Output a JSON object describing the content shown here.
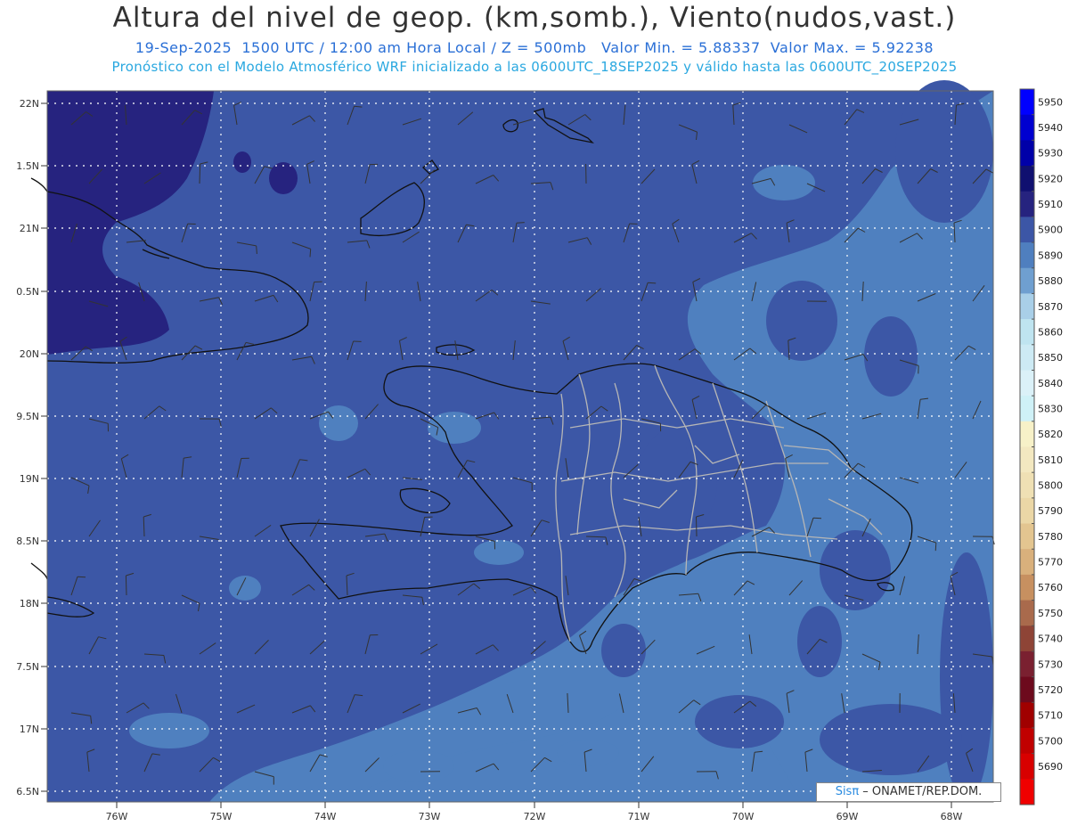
{
  "title": "Altura del nivel de geop. (km,somb.), Viento(nudos,vast.)",
  "subtitle1": "19-Sep-2025  1500 UTC / 12:00 am Hora Local / Z = 500mb   Valor Min. = 5.88337  Valor Max. = 5.92238",
  "subtitle2": "Pronóstico con el Modelo Atmosférico WRF inicializado a las 0600UTC_18SEP2025 y válido hasta las  0600UTC_20SEP2025",
  "lat_labels": [
    "22N",
    "1.5N",
    "21N",
    "0.5N",
    "20N",
    "9.5N",
    "19N",
    "8.5N",
    "18N",
    "7.5N",
    "17N",
    "6.5N"
  ],
  "lon_labels": [
    "76W",
    "75W",
    "74W",
    "73W",
    "72W",
    "71W",
    "70W",
    "69W",
    "68W"
  ],
  "colorbar": {
    "labels": [
      "5950",
      "5940",
      "5930",
      "5920",
      "5910",
      "5900",
      "5890",
      "5880",
      "5870",
      "5860",
      "5850",
      "5840",
      "5830",
      "5820",
      "5810",
      "5800",
      "5790",
      "5780",
      "5770",
      "5760",
      "5750",
      "5740",
      "5730",
      "5720",
      "5710",
      "5700",
      "5690"
    ],
    "colors": [
      "#0000ff",
      "#0000d0",
      "#0000a8",
      "#101070",
      "#26237f",
      "#3c56a6",
      "#4f7fbf",
      "#6f9fd0",
      "#a9cfe8",
      "#bfe4f0",
      "#cdeaf4",
      "#dbf1f8",
      "#cff1f7",
      "#f7f1c8",
      "#f3e8c0",
      "#efe0b4",
      "#ebd7a6",
      "#e3c590",
      "#d9b07c",
      "#c79060",
      "#a96a4c",
      "#8e4436",
      "#7a2030",
      "#6d0a1d",
      "#a00000",
      "#c00000",
      "#d80000",
      "#f00000"
    ]
  },
  "colors": {
    "base": "#3c57a6",
    "light": "#4f80bf",
    "dark": "#26237f",
    "coast": "#111111",
    "provinces": "#b6b6b6",
    "grid": "#ffffff"
  },
  "credit": {
    "brand": "Sisπ",
    "text": " – ONAMET/REP.DOM."
  }
}
